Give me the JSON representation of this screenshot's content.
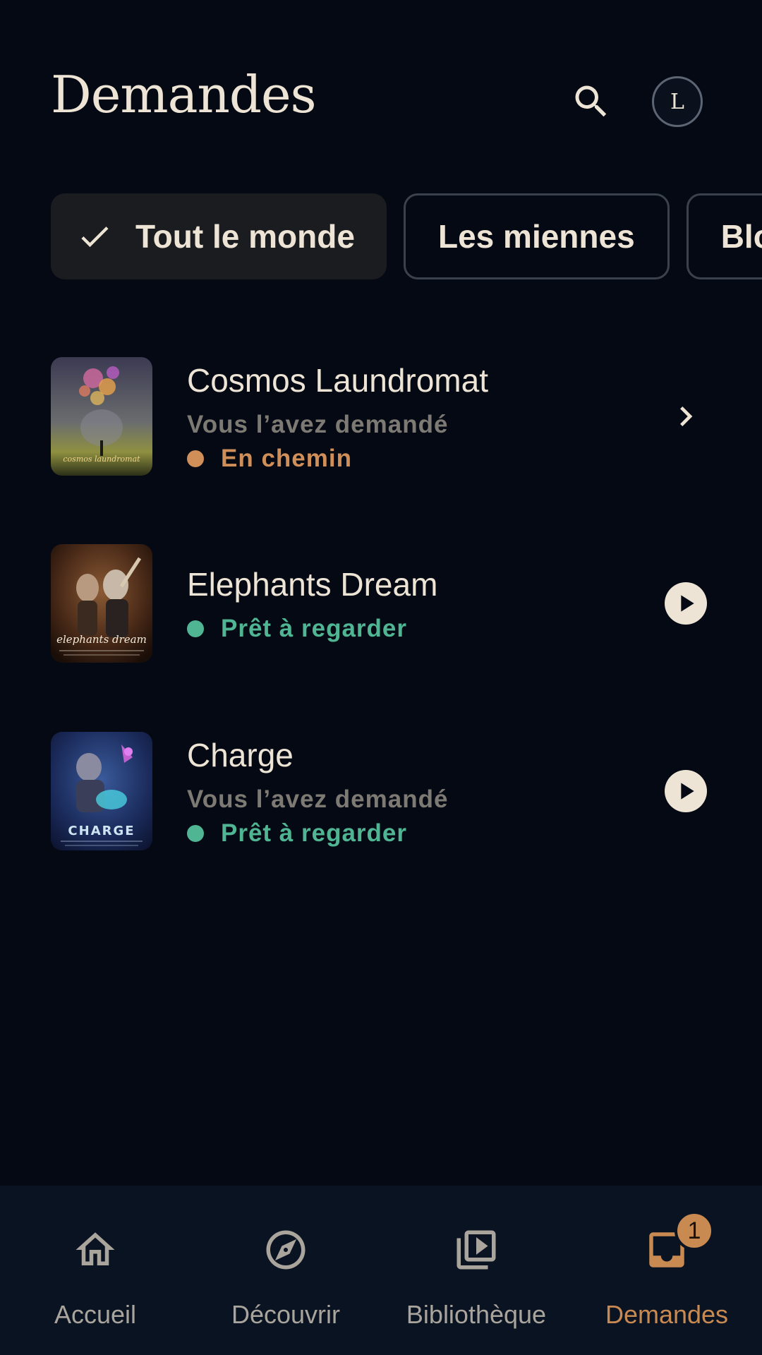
{
  "header": {
    "title": "Demandes",
    "avatar_initial": "L"
  },
  "filters": [
    {
      "label": "Tout le monde",
      "selected": true
    },
    {
      "label": "Les miennes",
      "selected": false
    },
    {
      "label": "Bloqué",
      "selected": false
    }
  ],
  "requests": [
    {
      "title": "Cosmos Laundromat",
      "subtitle": "Vous l’avez demandé",
      "status": "En chemin",
      "status_color": "#d08f58",
      "action": "chevron-right",
      "poster_text": "cosmos laundromat"
    },
    {
      "title": "Elephants Dream",
      "subtitle": "",
      "status": "Prêt à regarder",
      "status_color": "#4fb593",
      "action": "play",
      "poster_text": "elephants dream"
    },
    {
      "title": "Charge",
      "subtitle": "Vous l’avez demandé",
      "status": "Prêt à regarder",
      "status_color": "#4fb593",
      "action": "play",
      "poster_text": "CHARGE"
    }
  ],
  "bottom_nav": [
    {
      "label": "Accueil",
      "icon": "home-icon",
      "active": false
    },
    {
      "label": "Découvrir",
      "icon": "compass-icon",
      "active": false
    },
    {
      "label": "Bibliothèque",
      "icon": "library-icon",
      "active": false
    },
    {
      "label": "Demandes",
      "icon": "inbox-icon",
      "active": true,
      "badge": "1"
    }
  ],
  "colors": {
    "background": "#040913",
    "accent": "#c98a52",
    "ready": "#4fb593",
    "text": "#ede4d6"
  }
}
